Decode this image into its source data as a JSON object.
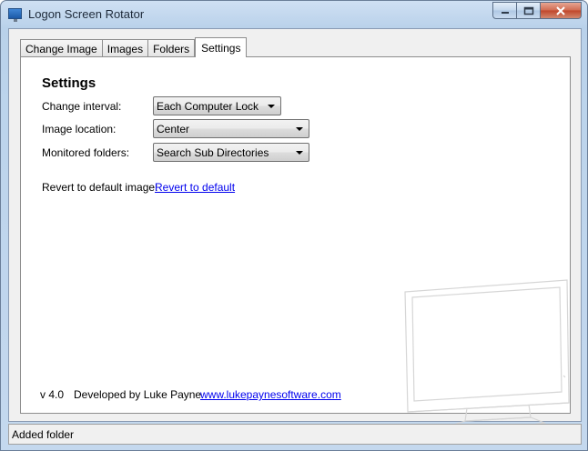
{
  "window": {
    "title": "Logon Screen Rotator",
    "caption": {
      "minimize": "▭",
      "maximize": "□",
      "close": "✕"
    }
  },
  "tabs": [
    {
      "label": "Change Image",
      "active": false
    },
    {
      "label": "Images",
      "active": false
    },
    {
      "label": "Folders",
      "active": false
    },
    {
      "label": "Settings",
      "active": true
    }
  ],
  "settings": {
    "heading": "Settings",
    "change_interval": {
      "label": "Change interval:",
      "value": "Each Computer Lock"
    },
    "image_location": {
      "label": "Image location:",
      "value": "Center"
    },
    "monitored_folders": {
      "label": "Monitored folders:",
      "value": "Search Sub Directories"
    },
    "revert": {
      "label": "Revert to default image:",
      "link": "Revert to default"
    }
  },
  "footer": {
    "version": "v 4.0",
    "developer": "Developed by Luke Payne",
    "website": "www.lukepaynesoftware.com"
  },
  "status": {
    "text": "Added folder"
  },
  "colors": {
    "link": "#0000ee",
    "close_button": "#c0462a",
    "titlebar": "#b9d1ea"
  }
}
